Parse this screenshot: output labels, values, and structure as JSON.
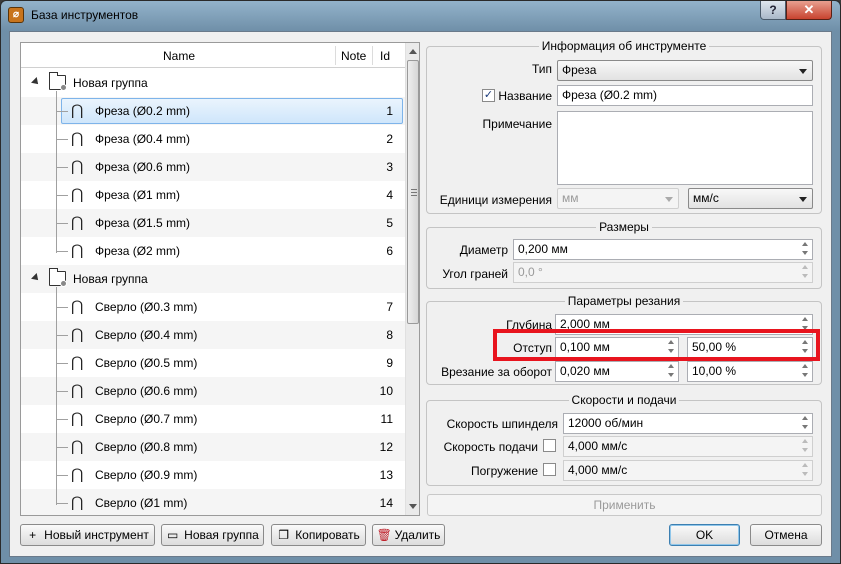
{
  "window": {
    "title": "База инструментов",
    "help": "?",
    "close": "✕"
  },
  "tree": {
    "columns": {
      "name": "Name",
      "note": "Note",
      "id": "Id"
    },
    "groups": [
      {
        "label": "Новая группа",
        "items": [
          {
            "label": "Фреза (Ø0.2 mm)",
            "id": "1"
          },
          {
            "label": "Фреза (Ø0.4 mm)",
            "id": "2"
          },
          {
            "label": "Фреза (Ø0.6 mm)",
            "id": "3"
          },
          {
            "label": "Фреза (Ø1 mm)",
            "id": "4"
          },
          {
            "label": "Фреза (Ø1.5 mm)",
            "id": "5"
          },
          {
            "label": "Фреза (Ø2 mm)",
            "id": "6"
          }
        ]
      },
      {
        "label": "Новая группа",
        "items": [
          {
            "label": "Сверло (Ø0.3 mm)",
            "id": "7"
          },
          {
            "label": "Сверло (Ø0.4 mm)",
            "id": "8"
          },
          {
            "label": "Сверло (Ø0.5 mm)",
            "id": "9"
          },
          {
            "label": "Сверло (Ø0.6 mm)",
            "id": "10"
          },
          {
            "label": "Сверло (Ø0.7 mm)",
            "id": "11"
          },
          {
            "label": "Сверло (Ø0.8 mm)",
            "id": "12"
          },
          {
            "label": "Сверло (Ø0.9 mm)",
            "id": "13"
          },
          {
            "label": "Сверло (Ø1 mm)",
            "id": "14"
          }
        ]
      }
    ]
  },
  "buttons": {
    "new_tool": "Новый инструмент",
    "new_group": "Новая группа",
    "copy": "Копировать",
    "delete": "Удалить",
    "apply": "Применить",
    "ok": "OK",
    "cancel": "Отмена"
  },
  "info": {
    "title": "Информация об инструменте",
    "type_label": "Тип",
    "type_value": "Фреза",
    "name_label": "Название",
    "name_checked": true,
    "name_value": "Фреза (Ø0.2 mm)",
    "note_label": "Примечание",
    "units_label": "Единици измерения",
    "units_length": "мм",
    "units_speed": "мм/с"
  },
  "dimensions": {
    "title": "Размеры",
    "diameter_label": "Диаметр",
    "diameter_value": "0,200 мм",
    "angle_label": "Угол граней",
    "angle_value": "0,0 °"
  },
  "cutting": {
    "title": "Параметры резания",
    "depth_label": "Глубина",
    "depth_value": "2,000 мм",
    "stepover_label": "Отступ",
    "stepover_value": "0,100 мм",
    "stepover_percent": "50,00 %",
    "plunge_label": "Врезание за оборот",
    "plunge_value": "0,020 мм",
    "plunge_percent": "10,00 %"
  },
  "speeds": {
    "title": "Скорости и подачи",
    "spindle_label": "Скорость шпинделя",
    "spindle_value": "12000 об/мин",
    "feed_label": "Скорость подачи",
    "feed_value": "4,000 мм/с",
    "plunge_label": "Погружение",
    "plunge_value": "4,000 мм/с"
  },
  "colors": {
    "highlight": "#e8141e",
    "selection": "#cfe6fb"
  }
}
